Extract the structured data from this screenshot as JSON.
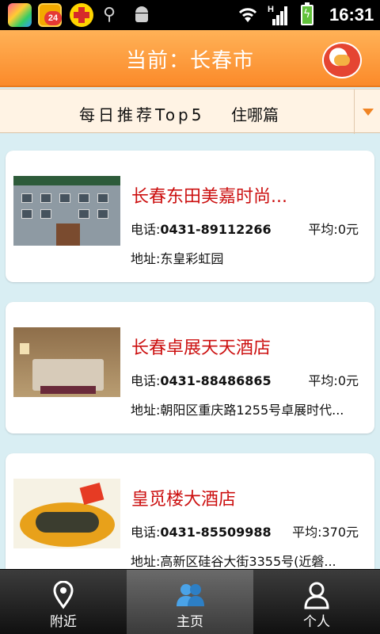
{
  "status_bar": {
    "notification_badge": "24",
    "time": "16:31",
    "signal_type": "H"
  },
  "header": {
    "title": "当前：长春市"
  },
  "filter": {
    "daily_tab": "每日推荐Top5",
    "stay_tab": "住哪篇"
  },
  "listings": [
    {
      "name": "长春东田美嘉时尚...",
      "phone_label": "电话:",
      "phone": "0431-89112266",
      "avg": "平均:0元",
      "address_label": "地址:",
      "address": "东皇彩虹园",
      "image": "hotel-building-photo"
    },
    {
      "name": "长春卓展天天酒店",
      "phone_label": "电话:",
      "phone": "0431-88486865",
      "avg": "平均:0元",
      "address_label": "地址:",
      "address": "朝阳区重庆路1255号卓展时代...",
      "image": "hotel-room-photo"
    },
    {
      "name": "皇觅楼大酒店",
      "phone_label": "电话:",
      "phone": "0431-85509988",
      "avg": "平均:370元",
      "address_label": "地址:",
      "address": "高新区硅谷大街3355号(近磐...",
      "image": "food-dish-photo"
    }
  ],
  "bottom_nav": {
    "nearby": "附近",
    "home": "主页",
    "me": "个人"
  },
  "colors": {
    "header_orange": "#fb8a2a",
    "name_red": "#cc1010",
    "page_bg": "#d9eef3"
  }
}
